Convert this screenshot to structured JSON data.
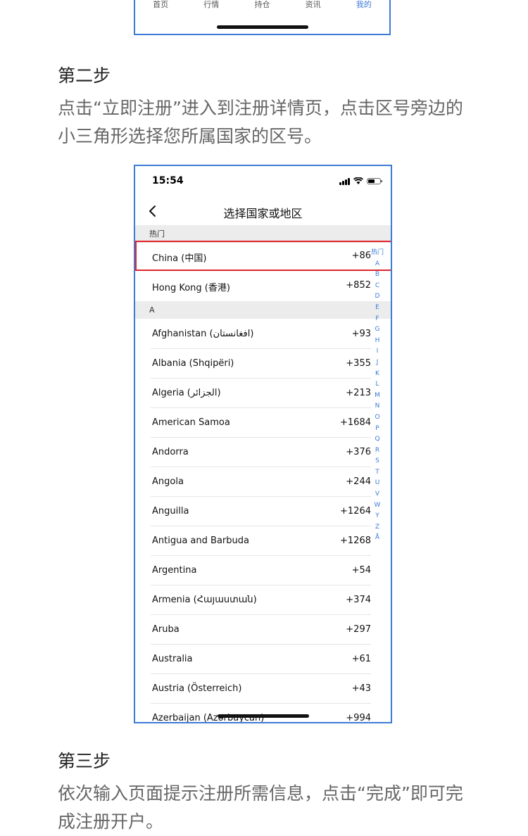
{
  "top_tabs": [
    {
      "label": "首页",
      "active": false
    },
    {
      "label": "行情",
      "active": false
    },
    {
      "label": "持仓",
      "active": false
    },
    {
      "label": "资讯",
      "active": false
    },
    {
      "label": "我的",
      "active": true
    }
  ],
  "step2": {
    "title": "第二步",
    "desc": "点击“立即注册”进入到注册详情页，点击区号旁边的小三角形选择您所属国家的区号。"
  },
  "phone": {
    "time": "15:54",
    "page_title": "选择国家或地区",
    "hot_header": "热门",
    "a_header": "A",
    "hot_rows": [
      {
        "name": "China (中国)",
        "code": "+86"
      },
      {
        "name": "Hong Kong (香港)",
        "code": "+852"
      }
    ],
    "a_rows": [
      {
        "name": "Afghanistan (افغانستان)",
        "code": "+93"
      },
      {
        "name": "Albania (Shqipëri)",
        "code": "+355"
      },
      {
        "name": "Algeria (الجزائر)",
        "code": "+213"
      },
      {
        "name": "American Samoa",
        "code": "+1684"
      },
      {
        "name": "Andorra",
        "code": "+376"
      },
      {
        "name": "Angola",
        "code": "+244"
      },
      {
        "name": "Anguilla",
        "code": "+1264"
      },
      {
        "name": "Antigua and Barbuda",
        "code": "+1268"
      },
      {
        "name": "Argentina",
        "code": "+54"
      },
      {
        "name": "Armenia (Հայաստան)",
        "code": "+374"
      },
      {
        "name": "Aruba",
        "code": "+297"
      },
      {
        "name": "Australia",
        "code": "+61"
      },
      {
        "name": "Austria (Österreich)",
        "code": "+43"
      },
      {
        "name": "Azerbaijan (Azərbaycan)",
        "code": "+994"
      }
    ],
    "index": [
      "热门",
      "A",
      "B",
      "C",
      "D",
      "E",
      "F",
      "G",
      "H",
      "I",
      "J",
      "K",
      "L",
      "M",
      "N",
      "O",
      "P",
      "Q",
      "R",
      "S",
      "T",
      "U",
      "V",
      "W",
      "Y",
      "Z",
      "Å"
    ]
  },
  "step3": {
    "title": "第三步",
    "desc": "依次输入页面提示注册所需信息，点击“完成”即可完成注册开户。"
  },
  "colors": {
    "accent": "#3d7bd6",
    "highlight": "#e0242a"
  }
}
